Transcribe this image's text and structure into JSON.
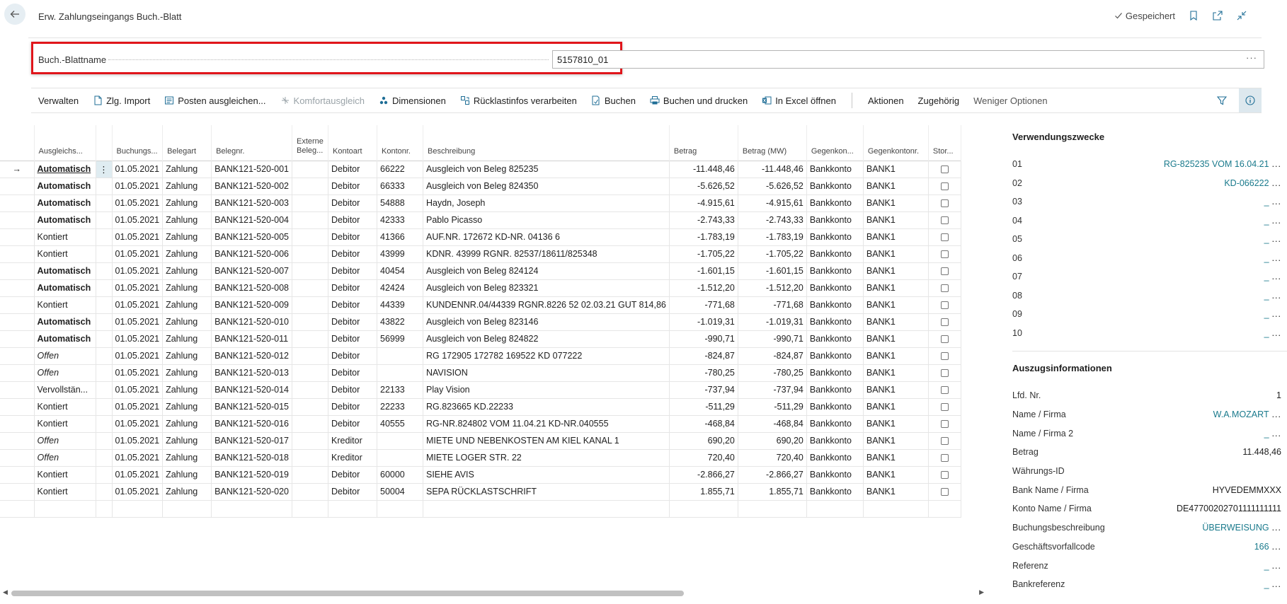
{
  "header": {
    "title": "Erw. Zahlungseingangs Buch.-Blatt",
    "saved": "Gespeichert"
  },
  "batch": {
    "label": "Buch.-Blattname",
    "value": "5157810_01",
    "more": "···"
  },
  "actions": {
    "items": [
      {
        "label": "Verwalten",
        "icon": "",
        "disabled": false
      },
      {
        "label": "Zlg. Import",
        "icon": "import-icon",
        "disabled": false
      },
      {
        "label": "Posten ausgleichen...",
        "icon": "apply-entries-icon",
        "disabled": false
      },
      {
        "label": "Komfortausgleich",
        "icon": "comfort-apply-icon",
        "disabled": true
      },
      {
        "label": "Dimensionen",
        "icon": "dimensions-icon",
        "disabled": false
      },
      {
        "label": "Rücklastinfos verarbeiten",
        "icon": "return-info-icon",
        "disabled": false
      },
      {
        "label": "Buchen",
        "icon": "post-icon",
        "disabled": false
      },
      {
        "label": "Buchen und drucken",
        "icon": "print-icon",
        "disabled": false
      },
      {
        "label": "In Excel öffnen",
        "icon": "excel-icon",
        "disabled": false
      }
    ],
    "secondary": [
      "Aktionen",
      "Zugehörig",
      "Weniger Optionen"
    ]
  },
  "table": {
    "columns": {
      "status": "Ausgleichs...",
      "date": "Buchungs...",
      "doctype": "Belegart",
      "docno": "Belegnr.",
      "extdoc": "Externe Beleg...",
      "acctype": "Kontoart",
      "accno": "Kontonr.",
      "desc": "Beschreibung",
      "amount": "Betrag",
      "amountlcy": "Betrag (MW)",
      "balacctype": "Gegenkon...",
      "balaccno": "Gegenkontonr.",
      "storno": "Stor..."
    },
    "rows": [
      {
        "status": "Automatisch",
        "st": "auto",
        "date": "01.05.2021",
        "doctype": "Zahlung",
        "docno": "BANK121-520-001",
        "extdoc": "",
        "acctype": "Debitor",
        "accno": "66222",
        "desc": "Ausgleich von Beleg 825235",
        "amount": "-11.448,46",
        "amountlcy": "-11.448,46",
        "balacctype": "Bankkonto",
        "balaccno": "BANK1"
      },
      {
        "status": "Automatisch",
        "st": "auto",
        "date": "01.05.2021",
        "doctype": "Zahlung",
        "docno": "BANK121-520-002",
        "extdoc": "",
        "acctype": "Debitor",
        "accno": "66333",
        "desc": "Ausgleich von Beleg 824350",
        "amount": "-5.626,52",
        "amountlcy": "-5.626,52",
        "balacctype": "Bankkonto",
        "balaccno": "BANK1"
      },
      {
        "status": "Automatisch",
        "st": "auto",
        "date": "01.05.2021",
        "doctype": "Zahlung",
        "docno": "BANK121-520-003",
        "extdoc": "",
        "acctype": "Debitor",
        "accno": "54888",
        "desc": "Haydn, Joseph",
        "amount": "-4.915,61",
        "amountlcy": "-4.915,61",
        "balacctype": "Bankkonto",
        "balaccno": "BANK1"
      },
      {
        "status": "Automatisch",
        "st": "auto",
        "date": "01.05.2021",
        "doctype": "Zahlung",
        "docno": "BANK121-520-004",
        "extdoc": "",
        "acctype": "Debitor",
        "accno": "42333",
        "desc": "Pablo Picasso",
        "amount": "-2.743,33",
        "amountlcy": "-2.743,33",
        "balacctype": "Bankkonto",
        "balaccno": "BANK1"
      },
      {
        "status": "Kontiert",
        "st": "kont",
        "date": "01.05.2021",
        "doctype": "Zahlung",
        "docno": "BANK121-520-005",
        "extdoc": "",
        "acctype": "Debitor",
        "accno": "41366",
        "desc": "AUF.NR. 172672 KD-NR. 04136 6",
        "amount": "-1.783,19",
        "amountlcy": "-1.783,19",
        "balacctype": "Bankkonto",
        "balaccno": "BANK1"
      },
      {
        "status": "Kontiert",
        "st": "kont",
        "date": "01.05.2021",
        "doctype": "Zahlung",
        "docno": "BANK121-520-006",
        "extdoc": "",
        "acctype": "Debitor",
        "accno": "43999",
        "desc": "KDNR. 43999 RGNR. 82537/18611/825348",
        "amount": "-1.705,22",
        "amountlcy": "-1.705,22",
        "balacctype": "Bankkonto",
        "balaccno": "BANK1"
      },
      {
        "status": "Automatisch",
        "st": "auto",
        "date": "01.05.2021",
        "doctype": "Zahlung",
        "docno": "BANK121-520-007",
        "extdoc": "",
        "acctype": "Debitor",
        "accno": "40454",
        "desc": "Ausgleich von Beleg 824124",
        "amount": "-1.601,15",
        "amountlcy": "-1.601,15",
        "balacctype": "Bankkonto",
        "balaccno": "BANK1"
      },
      {
        "status": "Automatisch",
        "st": "auto",
        "date": "01.05.2021",
        "doctype": "Zahlung",
        "docno": "BANK121-520-008",
        "extdoc": "",
        "acctype": "Debitor",
        "accno": "42424",
        "desc": "Ausgleich von Beleg 823321",
        "amount": "-1.512,20",
        "amountlcy": "-1.512,20",
        "balacctype": "Bankkonto",
        "balaccno": "BANK1"
      },
      {
        "status": "Kontiert",
        "st": "kont",
        "date": "01.05.2021",
        "doctype": "Zahlung",
        "docno": "BANK121-520-009",
        "extdoc": "",
        "acctype": "Debitor",
        "accno": "44339",
        "desc": "KUNDENNR.04/44339 RGNR.8226 52 02.03.21 GUT 814,86",
        "amount": "-771,68",
        "amountlcy": "-771,68",
        "balacctype": "Bankkonto",
        "balaccno": "BANK1"
      },
      {
        "status": "Automatisch",
        "st": "auto",
        "date": "01.05.2021",
        "doctype": "Zahlung",
        "docno": "BANK121-520-010",
        "extdoc": "",
        "acctype": "Debitor",
        "accno": "43822",
        "desc": "Ausgleich von Beleg 823146",
        "amount": "-1.019,31",
        "amountlcy": "-1.019,31",
        "balacctype": "Bankkonto",
        "balaccno": "BANK1"
      },
      {
        "status": "Automatisch",
        "st": "auto",
        "date": "01.05.2021",
        "doctype": "Zahlung",
        "docno": "BANK121-520-011",
        "extdoc": "",
        "acctype": "Debitor",
        "accno": "56999",
        "desc": "Ausgleich von Beleg 824822",
        "amount": "-990,71",
        "amountlcy": "-990,71",
        "balacctype": "Bankkonto",
        "balaccno": "BANK1"
      },
      {
        "status": "Offen",
        "st": "offen",
        "date": "01.05.2021",
        "doctype": "Zahlung",
        "docno": "BANK121-520-012",
        "extdoc": "",
        "acctype": "Debitor",
        "accno": "",
        "desc": "RG 172905 172782 169522 KD 077222",
        "amount": "-824,87",
        "amountlcy": "-824,87",
        "balacctype": "Bankkonto",
        "balaccno": "BANK1"
      },
      {
        "status": "Offen",
        "st": "offen",
        "date": "01.05.2021",
        "doctype": "Zahlung",
        "docno": "BANK121-520-013",
        "extdoc": "",
        "acctype": "Debitor",
        "accno": "",
        "desc": "NAVISION",
        "amount": "-780,25",
        "amountlcy": "-780,25",
        "balacctype": "Bankkonto",
        "balaccno": "BANK1"
      },
      {
        "status": "Vervollstän...",
        "st": "verv",
        "date": "01.05.2021",
        "doctype": "Zahlung",
        "docno": "BANK121-520-014",
        "extdoc": "",
        "acctype": "Debitor",
        "accno": "22133",
        "desc": "Play Vision",
        "amount": "-737,94",
        "amountlcy": "-737,94",
        "balacctype": "Bankkonto",
        "balaccno": "BANK1"
      },
      {
        "status": "Kontiert",
        "st": "kont",
        "date": "01.05.2021",
        "doctype": "Zahlung",
        "docno": "BANK121-520-015",
        "extdoc": "",
        "acctype": "Debitor",
        "accno": "22233",
        "desc": "RG.823665 KD.22233",
        "amount": "-511,29",
        "amountlcy": "-511,29",
        "balacctype": "Bankkonto",
        "balaccno": "BANK1"
      },
      {
        "status": "Kontiert",
        "st": "kont",
        "date": "01.05.2021",
        "doctype": "Zahlung",
        "docno": "BANK121-520-016",
        "extdoc": "",
        "acctype": "Debitor",
        "accno": "40555",
        "desc": "RG-NR.824802 VOM 11.04.21 KD-NR.040555",
        "amount": "-468,84",
        "amountlcy": "-468,84",
        "balacctype": "Bankkonto",
        "balaccno": "BANK1"
      },
      {
        "status": "Offen",
        "st": "offen",
        "date": "01.05.2021",
        "doctype": "Zahlung",
        "docno": "BANK121-520-017",
        "extdoc": "",
        "acctype": "Kreditor",
        "accno": "",
        "desc": "MIETE UND NEBENKOSTEN AM KIEL KANAL 1",
        "amount": "690,20",
        "amountlcy": "690,20",
        "balacctype": "Bankkonto",
        "balaccno": "BANK1"
      },
      {
        "status": "Offen",
        "st": "offen",
        "date": "01.05.2021",
        "doctype": "Zahlung",
        "docno": "BANK121-520-018",
        "extdoc": "",
        "acctype": "Kreditor",
        "accno": "",
        "desc": "MIETE LOGER STR. 22",
        "amount": "720,40",
        "amountlcy": "720,40",
        "balacctype": "Bankkonto",
        "balaccno": "BANK1"
      },
      {
        "status": "Kontiert",
        "st": "kont",
        "date": "01.05.2021",
        "doctype": "Zahlung",
        "docno": "BANK121-520-019",
        "extdoc": "",
        "acctype": "Debitor",
        "accno": "60000",
        "desc": "SIEHE AVIS",
        "amount": "-2.866,27",
        "amountlcy": "-2.866,27",
        "balacctype": "Bankkonto",
        "balaccno": "BANK1"
      },
      {
        "status": "Kontiert",
        "st": "kont",
        "date": "01.05.2021",
        "doctype": "Zahlung",
        "docno": "BANK121-520-020",
        "extdoc": "",
        "acctype": "Debitor",
        "accno": "50004",
        "desc": "SEPA RÜCKLASTSCHRIFT",
        "amount": "1.855,71",
        "amountlcy": "1.855,71",
        "balacctype": "Bankkonto",
        "balaccno": "BANK1"
      }
    ]
  },
  "factbox": {
    "purposes_title": "Verwendungszwecke",
    "purposes": [
      {
        "k": "01",
        "v": "RG-825235 VOM 16.04.21"
      },
      {
        "k": "02",
        "v": "KD-066222"
      },
      {
        "k": "03",
        "v": "_"
      },
      {
        "k": "04",
        "v": "_"
      },
      {
        "k": "05",
        "v": "_"
      },
      {
        "k": "06",
        "v": "_"
      },
      {
        "k": "07",
        "v": "_"
      },
      {
        "k": "08",
        "v": "_"
      },
      {
        "k": "09",
        "v": "_"
      },
      {
        "k": "10",
        "v": "_"
      }
    ],
    "statement_title": "Auszugsinformationen",
    "statement": [
      {
        "k": "Lfd. Nr.",
        "v": "1",
        "link": false,
        "more": false
      },
      {
        "k": "Name / Firma",
        "v": "W.A.MOZART",
        "link": true,
        "more": true
      },
      {
        "k": "Name / Firma 2",
        "v": "_",
        "link": true,
        "more": true
      },
      {
        "k": "Betrag",
        "v": "11.448,46",
        "link": false,
        "more": false
      },
      {
        "k": "Währungs-ID",
        "v": "",
        "link": false,
        "more": false
      },
      {
        "k": "Bank Name / Firma",
        "v": "HYVEDEMMXXX",
        "link": false,
        "more": false
      },
      {
        "k": "Konto Name / Firma",
        "v": "DE47700202701111111111",
        "link": false,
        "more": false
      },
      {
        "k": "Buchungsbeschreibung",
        "v": "ÜBERWEISUNG",
        "link": true,
        "more": true
      },
      {
        "k": "Geschäftsvorfallcode",
        "v": "166",
        "link": true,
        "more": true
      },
      {
        "k": "Referenz",
        "v": "_",
        "link": true,
        "more": true
      },
      {
        "k": "Bankreferenz",
        "v": "_",
        "link": true,
        "more": true
      }
    ],
    "more": "..."
  },
  "colors": {
    "automatisch": "#2b7a1f",
    "kontiert": "#8a7f12",
    "offen": "#d4302a",
    "vervollstaendigt": "#1a7a8c",
    "accent": "#1f6e96",
    "highlight_border": "#e0151b"
  }
}
